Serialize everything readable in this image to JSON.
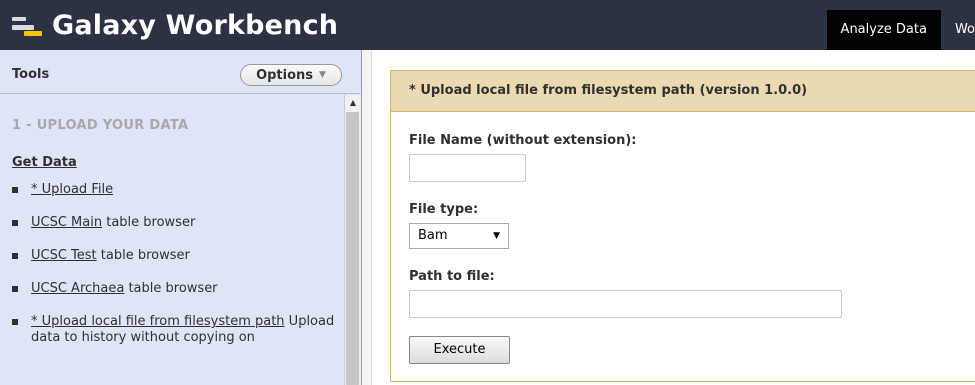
{
  "masthead": {
    "brand": "Galaxy Workbench",
    "tabs": [
      {
        "label": "Analyze Data",
        "active": true
      },
      {
        "label": "Wo",
        "active": false
      }
    ]
  },
  "tool_panel": {
    "title": "Tools",
    "options_label": "Options",
    "section": "1 - UPLOAD YOUR DATA",
    "group": "Get Data",
    "tools": [
      {
        "link": "* Upload File",
        "desc": ""
      },
      {
        "link": "UCSC Main",
        "desc": " table browser"
      },
      {
        "link": "UCSC Test",
        "desc": " table browser"
      },
      {
        "link": "UCSC Archaea",
        "desc": " table browser"
      },
      {
        "link": "* Upload local file from filesystem path",
        "desc": " Upload data to history without copying on"
      }
    ]
  },
  "form": {
    "title": "* Upload local file from filesystem path (version 1.0.0)",
    "file_name_label": "File Name (without extension):",
    "file_name_value": "",
    "file_type_label": "File type:",
    "file_type_value": "Bam",
    "path_label": "Path to file:",
    "path_value": "",
    "execute_label": "Execute"
  },
  "colors": {
    "masthead": "#2c3143",
    "tool_panel_bg": "#dfe5f9",
    "form_header_bg": "#ebd9b2",
    "form_border": "#d8b365",
    "logo_accent": "#f5c300"
  }
}
